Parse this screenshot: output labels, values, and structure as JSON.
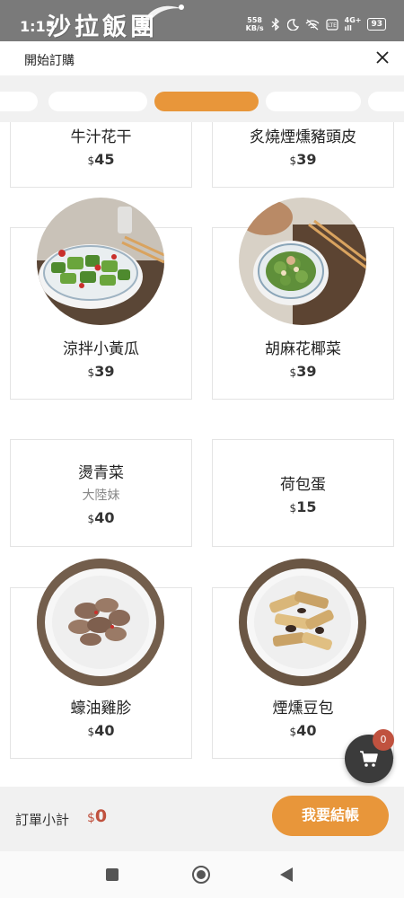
{
  "status_bar": {
    "time": "1:15",
    "at_symbol": "@ ·",
    "brand": "沙拉飯團",
    "net_speed_top": "558",
    "net_speed_bottom": "KB/s",
    "signal_top": "4G+",
    "signal_bottom": "ıll",
    "battery": "93",
    "icons": [
      "bluetooth-icon",
      "moon-icon",
      "wifi-off-icon",
      "lte-icon"
    ]
  },
  "header": {
    "title": "開始訂購",
    "close_icon": "close-icon"
  },
  "menu": {
    "items": [
      {
        "name": "牛汁花干",
        "price": "45",
        "currency": "$"
      },
      {
        "name": "炙燒煙燻豬頭皮",
        "price": "39",
        "currency": "$"
      },
      {
        "name": "涼拌小黃瓜",
        "price": "39",
        "currency": "$",
        "image": "cucumber-salad"
      },
      {
        "name": "胡麻花椰菜",
        "price": "39",
        "currency": "$",
        "image": "sesame-broccoli"
      },
      {
        "name": "燙青菜",
        "subtitle": "大陸妹",
        "price": "40",
        "currency": "$"
      },
      {
        "name": "荷包蛋",
        "price": "15",
        "currency": "$"
      },
      {
        "name": "蠔油雞胗",
        "price": "40",
        "currency": "$",
        "image": "oyster-sauce-gizzard"
      },
      {
        "name": "煙燻豆包",
        "price": "40",
        "currency": "$",
        "image": "smoked-tofu-skin"
      }
    ]
  },
  "cart": {
    "badge_count": "0",
    "icon": "cart-icon"
  },
  "order_bar": {
    "subtotal_label": "訂單小計",
    "currency": "$",
    "subtotal_value": "0",
    "checkout_label": "我要結帳"
  },
  "colors": {
    "accent": "#e8963a",
    "price_red": "#c0523f",
    "status_bar": "#7a7a7a",
    "strip_bg": "#f1f1f1"
  }
}
